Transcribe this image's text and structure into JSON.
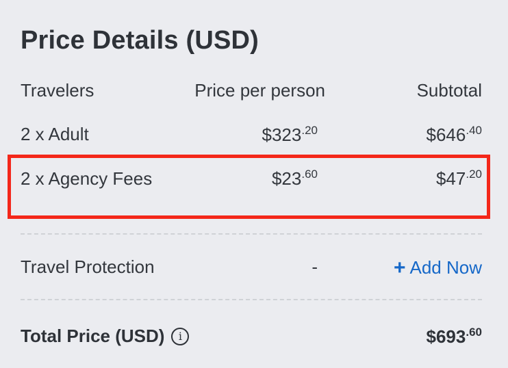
{
  "title": "Price Details (USD)",
  "headers": {
    "travelers": "Travelers",
    "price_per_person": "Price per person",
    "subtotal": "Subtotal"
  },
  "rows": [
    {
      "label": "2 x Adult",
      "price_main": "$323",
      "price_cents": ".20",
      "subtotal_main": "$646",
      "subtotal_cents": ".40"
    },
    {
      "label": "2 x Agency Fees",
      "price_main": "$23",
      "price_cents": ".60",
      "subtotal_main": "$47",
      "subtotal_cents": ".20"
    }
  ],
  "travel_protection": {
    "label": "Travel Protection",
    "price": "-",
    "add_plus": "+",
    "add_label": "Add Now"
  },
  "total": {
    "label": "Total Price (USD)",
    "info_glyph": "i",
    "main": "$693",
    "cents": ".60"
  },
  "colors": {
    "background": "#ebecf0",
    "link": "#1668c8",
    "highlight": "#f4271a"
  }
}
